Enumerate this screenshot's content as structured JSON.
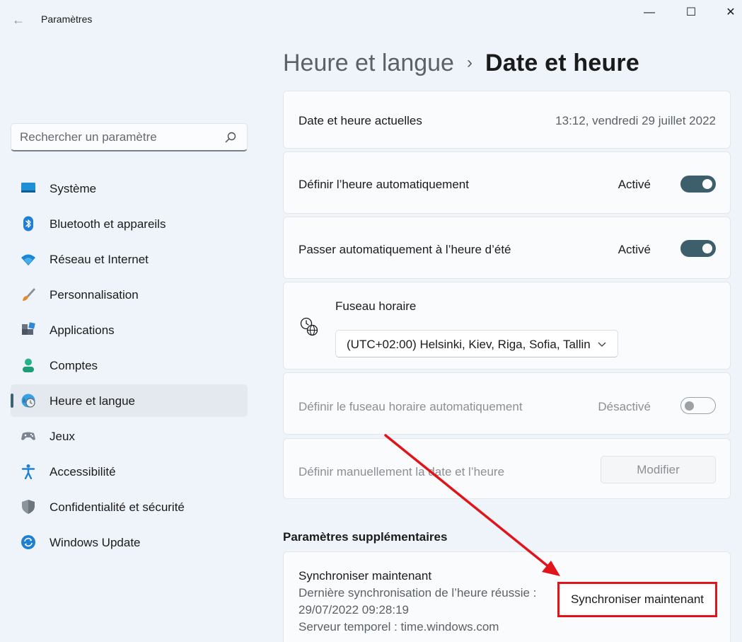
{
  "window": {
    "title": "Paramètres",
    "back_glyph": "←",
    "minimize_glyph": "—",
    "maximize_glyph": "☐",
    "close_glyph": "✕"
  },
  "search": {
    "placeholder": "Rechercher un paramètre",
    "value": ""
  },
  "sidebar": {
    "items": [
      {
        "label": "Système",
        "icon": "monitor-icon"
      },
      {
        "label": "Bluetooth et appareils",
        "icon": "bluetooth-icon"
      },
      {
        "label": "Réseau et Internet",
        "icon": "wifi-icon"
      },
      {
        "label": "Personnalisation",
        "icon": "paintbrush-icon"
      },
      {
        "label": "Applications",
        "icon": "apps-icon"
      },
      {
        "label": "Comptes",
        "icon": "person-icon"
      },
      {
        "label": "Heure et langue",
        "icon": "globe-clock-icon",
        "active": true
      },
      {
        "label": "Jeux",
        "icon": "gamepad-icon"
      },
      {
        "label": "Accessibilité",
        "icon": "accessibility-icon"
      },
      {
        "label": "Confidentialité et sécurité",
        "icon": "shield-icon"
      },
      {
        "label": "Windows Update",
        "icon": "update-icon"
      }
    ]
  },
  "header": {
    "parent": "Heure et langue",
    "separator": "›",
    "current": "Date et heure"
  },
  "settings": {
    "current_datetime": {
      "label": "Date et heure actuelles",
      "value": "13:12, vendredi 29 juillet 2022"
    },
    "auto_time": {
      "label": "Définir l’heure automatiquement",
      "state": "Activé"
    },
    "auto_dst": {
      "label": "Passer automatiquement à l’heure d’été",
      "state": "Activé"
    },
    "timezone": {
      "label": "Fuseau horaire",
      "value": "(UTC+02:00) Helsinki, Kiev, Riga, Sofia, Tallin"
    },
    "auto_timezone": {
      "label": "Définir le fuseau horaire automatiquement",
      "state": "Désactivé"
    },
    "manual_datetime": {
      "label": "Définir manuellement la date et l’heure",
      "button": "Modifier"
    }
  },
  "additional": {
    "section_title": "Paramètres supplémentaires",
    "sync": {
      "title": "Synchroniser maintenant",
      "last_sync_line1": "Dernière synchronisation de l’heure réussie :",
      "last_sync_line2": "29/07/2022 09:28:19",
      "server": "Serveur temporel : time.windows.com",
      "button": "Synchroniser maintenant"
    }
  },
  "colors": {
    "accent": "#3d5f6c",
    "annotation_red": "#e0141a",
    "background": "#eef4f9"
  }
}
